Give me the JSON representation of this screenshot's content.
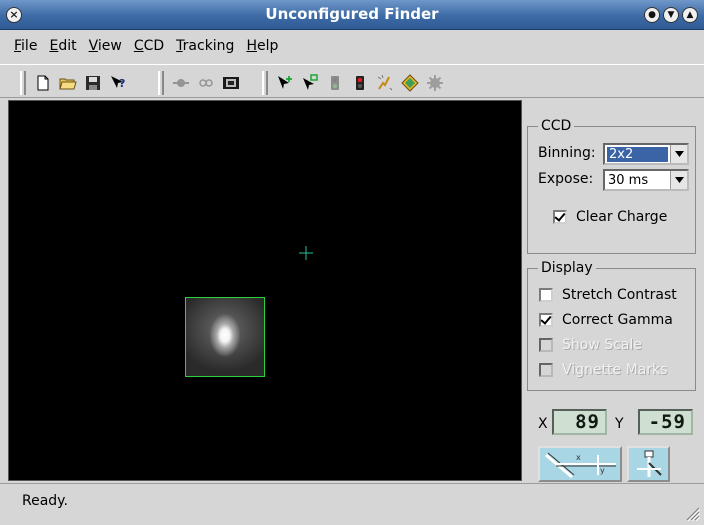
{
  "window": {
    "title": "Unconfigured Finder",
    "close_icon": "×"
  },
  "menu": [
    {
      "label_ul": "F",
      "label_rest": "ile"
    },
    {
      "label_ul": "E",
      "label_rest": "dit"
    },
    {
      "label_ul": "V",
      "label_rest": "iew"
    },
    {
      "label_ul": "C",
      "label_rest": "CD"
    },
    {
      "label_ul": "T",
      "label_rest": "racking"
    },
    {
      "label_ul": "H",
      "label_rest": "elp"
    }
  ],
  "toolbar_icons": {
    "group1": [
      "new-file-icon",
      "open-folder-icon",
      "save-icon",
      "whats-this-icon"
    ],
    "group2": [
      "single-capture-icon",
      "continuous-capture-icon",
      "stop-capture-icon"
    ],
    "group3": [
      "select-green-icon",
      "select-box-icon",
      "green-light-icon",
      "red-light-icon",
      "flash-icon",
      "diamond-icon",
      "gear-icon"
    ]
  },
  "ccd": {
    "title": "CCD",
    "binning_label": "Binning:",
    "binning_value": "2x2",
    "expose_label": "Expose:",
    "expose_value": "30 ms",
    "clear_charge_label": "Clear Charge",
    "clear_charge_checked": true
  },
  "display": {
    "title": "Display",
    "options": [
      {
        "label": "Stretch Contrast",
        "checked": false,
        "enabled": true
      },
      {
        "label": "Correct Gamma",
        "checked": true,
        "enabled": true
      },
      {
        "label": "Show Scale",
        "checked": false,
        "enabled": false
      },
      {
        "label": "Vignette Marks",
        "checked": false,
        "enabled": false
      }
    ]
  },
  "coords": {
    "x_label": "X",
    "x_value": "89",
    "y_label": "Y",
    "y_value": "-59"
  },
  "status": {
    "text": "Ready."
  },
  "colors": {
    "title_bar": "#3d6ba5",
    "viewer_bg": "#000000",
    "star_box_border": "#2bd33a",
    "crosshair": "#22c0a0",
    "lcd_bg": "#cfe0d3"
  }
}
